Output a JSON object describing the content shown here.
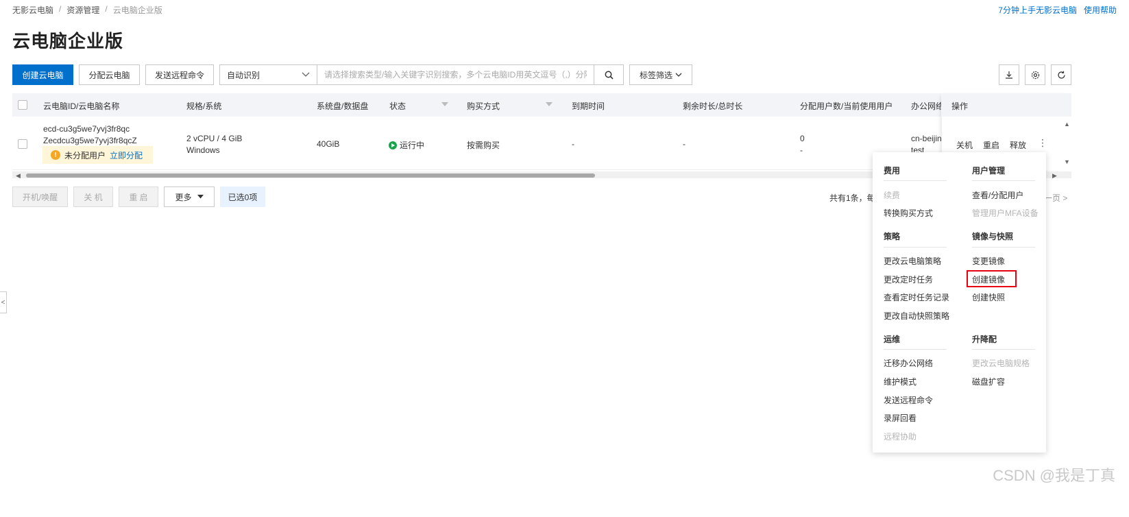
{
  "breadcrumb": {
    "items": [
      "无影云电脑",
      "资源管理",
      "云电脑企业版"
    ],
    "sep": "/"
  },
  "help_links": [
    "7分钟上手无影云电脑",
    "使用帮助"
  ],
  "page_title": "云电脑企业版",
  "toolbar": {
    "create": "创建云电脑",
    "assign": "分配云电脑",
    "send_command": "发送远程命令",
    "search_type": "自动识别",
    "search_placeholder": "请选择搜索类型/输入关键字识别搜索，多个云电脑ID用英文逗号（,）分隔",
    "tag_filter": "标签筛选"
  },
  "table": {
    "columns": [
      "云电脑ID/云电脑名称",
      "规格/系统",
      "系统盘/数据盘",
      "状态",
      "购买方式",
      "到期时间",
      "剩余时长/总时长",
      "分配用户数/当前使用用户",
      "办公网络",
      "操作"
    ],
    "rows": [
      {
        "id": "ecd-cu3g5we7yvj3fr8qc",
        "name": "Zecdcu3g5we7yvj3fr8qcZ",
        "unassigned": "未分配用户",
        "assign_now": "立即分配",
        "spec": "2 vCPU / 4 GiB",
        "os": "Windows",
        "disk": "40GiB",
        "status": "运行中",
        "purchase": "按需购买",
        "expire": "-",
        "remaining": "-",
        "user_count": "0",
        "current_user": "-",
        "network": "cn-beijin",
        "network_sub": "test",
        "actions": [
          "关机",
          "重启",
          "释放"
        ]
      }
    ]
  },
  "footer": {
    "start": "开机/唤醒",
    "shutdown": "关 机",
    "restart": "重 启",
    "more": "更多",
    "selected": "已选0项",
    "pager_text": "共有1条，每",
    "next_page": "一页 >"
  },
  "dropdown": {
    "sections": [
      {
        "title": "费用",
        "items": [
          {
            "label": "续费",
            "disabled": true
          },
          {
            "label": "转换购买方式",
            "disabled": false
          }
        ]
      },
      {
        "title": "用户管理",
        "items": [
          {
            "label": "查看/分配用户",
            "disabled": false
          },
          {
            "label": "管理用户MFA设备",
            "disabled": true
          }
        ]
      },
      {
        "title": "策略",
        "items": [
          {
            "label": "更改云电脑策略",
            "disabled": false
          },
          {
            "label": "更改定时任务",
            "disabled": false
          },
          {
            "label": "查看定时任务记录",
            "disabled": false
          },
          {
            "label": "更改自动快照策略",
            "disabled": false
          }
        ]
      },
      {
        "title": "镜像与快照",
        "items": [
          {
            "label": "变更镜像",
            "disabled": false
          },
          {
            "label": "创建镜像",
            "disabled": false
          },
          {
            "label": "创建快照",
            "disabled": false
          }
        ]
      },
      {
        "title": "运维",
        "items": [
          {
            "label": "迁移办公网络",
            "disabled": false
          },
          {
            "label": "维护模式",
            "disabled": false
          },
          {
            "label": "发送远程命令",
            "disabled": false
          },
          {
            "label": "录屏回看",
            "disabled": false
          },
          {
            "label": "远程协助",
            "disabled": true
          }
        ]
      },
      {
        "title": "升降配",
        "items": [
          {
            "label": "更改云电脑规格",
            "disabled": true
          },
          {
            "label": "磁盘扩容",
            "disabled": false
          }
        ]
      }
    ]
  },
  "watermark": "CSDN @我是丁真",
  "colors": {
    "primary": "#0070cc",
    "running": "#1aa34a",
    "highlight": "#e60012",
    "warning": "#f5a623"
  }
}
